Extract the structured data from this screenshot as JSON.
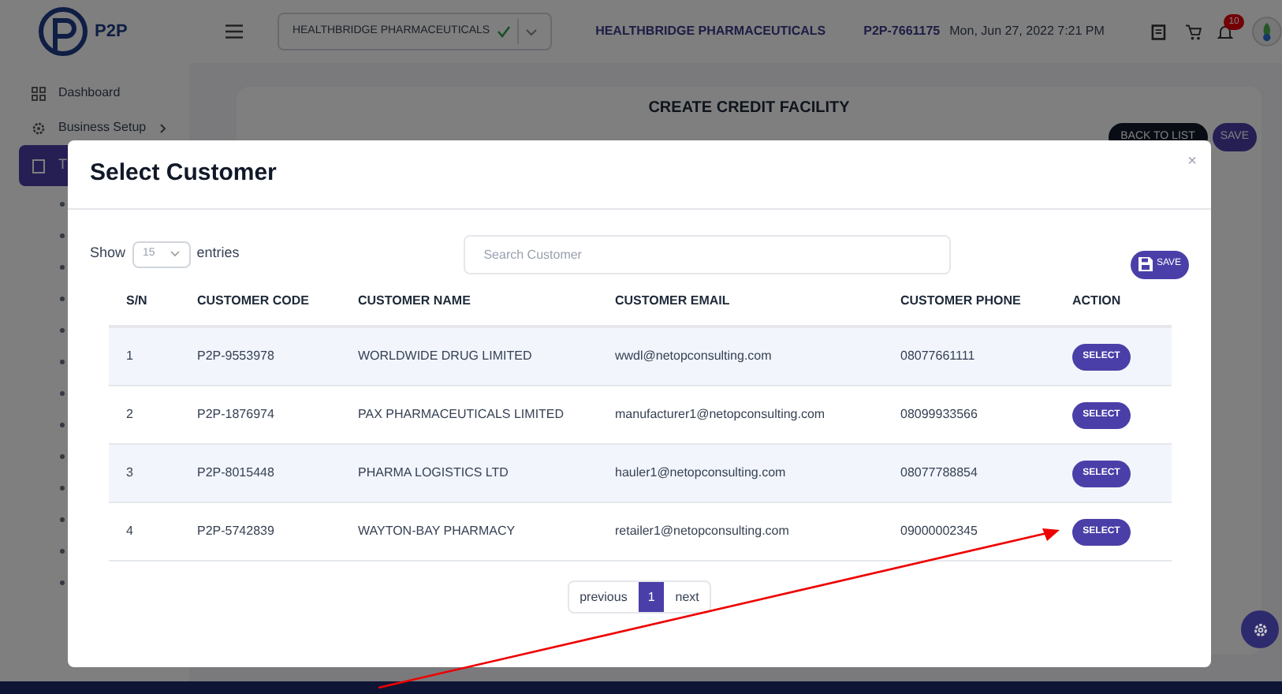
{
  "header": {
    "logo_text": "P2P",
    "company_select": "HEALTHBRIDGE PHARMACEUTICALS",
    "company_name": "HEALTHBRIDGE PHARMACEUTICALS",
    "account_code": "P2P-7661175",
    "datetime": "Mon, Jun 27, 2022 7:21 PM",
    "notification_count": "10"
  },
  "sidebar": {
    "items": [
      {
        "label": "Dashboard",
        "selected": false
      },
      {
        "label": "Business Setup",
        "selected": false
      },
      {
        "label": "T",
        "selected": true
      }
    ]
  },
  "page": {
    "title": "CREATE CREDIT FACILITY",
    "buttons": [
      "BACK TO LIST",
      "SAVE"
    ]
  },
  "modal": {
    "title": "Select Customer",
    "close": "×",
    "show_label": "Show",
    "page_size": "15",
    "entries_label": "entries",
    "search": {
      "placeholder": "Search Customer"
    },
    "save_button": "SAVE",
    "table": {
      "columns": [
        "S/N",
        "CUSTOMER CODE",
        "CUSTOMER NAME",
        "CUSTOMER EMAIL",
        "CUSTOMER PHONE",
        "ACTION"
      ],
      "rows": [
        {
          "sn": "1",
          "code": "P2P-9553978",
          "name": "WORLDWIDE DRUG LIMITED",
          "email": "wwdl@netopconsulting.com",
          "phone": "08077661111",
          "action": "SELECT"
        },
        {
          "sn": "2",
          "code": "P2P-1876974",
          "name": "PAX PHARMACEUTICALS LIMITED",
          "email": "manufacturer1@netopconsulting.com",
          "phone": "08099933566",
          "action": "SELECT"
        },
        {
          "sn": "3",
          "code": "P2P-8015448",
          "name": "PHARMA LOGISTICS LTD",
          "email": "hauler1@netopconsulting.com",
          "phone": "08077788854",
          "action": "SELECT"
        },
        {
          "sn": "4",
          "code": "P2P-5742839",
          "name": "WAYTON-BAY PHARMACY",
          "email": "retailer1@netopconsulting.com",
          "phone": "09000002345",
          "action": "SELECT"
        }
      ]
    },
    "pagination": [
      {
        "label": "previous",
        "selected": false
      },
      {
        "label": "1",
        "selected": true
      },
      {
        "label": "next",
        "selected": false
      }
    ]
  }
}
